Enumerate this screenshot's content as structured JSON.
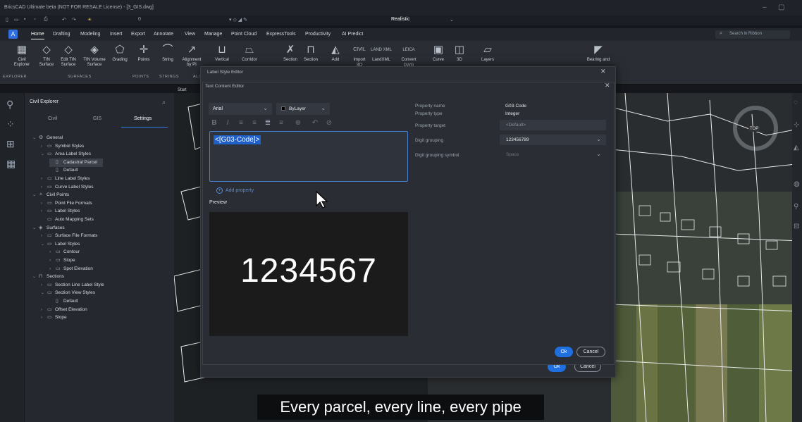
{
  "titlebar": {
    "title": "BricsCAD Ultimate beta (NOT FOR RESALE License) - [3_GIS.dwg]",
    "minimize": "–",
    "restore": "▢"
  },
  "qat": {
    "layer": "0",
    "visual_style": "Realistic"
  },
  "menubar": {
    "app_button": "A",
    "tabs": [
      "Home",
      "Drafting",
      "Modeling",
      "Insert",
      "Export",
      "Annotate",
      "View",
      "Manage",
      "Point Cloud",
      "ExpressTools",
      "Productivity",
      "AI Predict"
    ],
    "search_placeholder": "Search in Ribbon"
  },
  "ribbon": {
    "buttons": [
      {
        "label": "Civil Explorer",
        "icon": "civil-explorer-icon"
      },
      {
        "label": "TIN Surface",
        "icon": "tin-surface-icon"
      },
      {
        "label": "Edit TIN Surface",
        "icon": "edit-tin-icon"
      },
      {
        "label": "TIN Volume Surface",
        "icon": "tin-volume-icon"
      },
      {
        "label": "Grading",
        "icon": "grading-icon"
      },
      {
        "label": "Points",
        "icon": "points-icon"
      },
      {
        "label": "String",
        "icon": "string-icon"
      },
      {
        "label": "Alignment by PI",
        "icon": "alignment-icon"
      },
      {
        "label": "Vertical",
        "icon": "vertical-icon"
      },
      {
        "label": "Corridor",
        "icon": "corridor-icon"
      },
      {
        "label": "Section",
        "icon": "section-icon"
      },
      {
        "label": "Section",
        "icon": "section-view-icon"
      },
      {
        "label": "Add",
        "icon": "add-label-icon"
      },
      {
        "label": "Import",
        "icon": "import-icon"
      },
      {
        "label": "LandXML",
        "icon": "landxml-icon"
      },
      {
        "label": "Convert",
        "icon": "convert-icon"
      },
      {
        "label": "Curve",
        "icon": "curve-icon"
      },
      {
        "label": "3D",
        "icon": "3d-icon"
      },
      {
        "label": "Layers",
        "icon": "layers-icon"
      },
      {
        "label": "Bearing and",
        "icon": "bearing-icon"
      }
    ],
    "small_labels": [
      "CIVIL 3D",
      "LAND XML",
      "LEICA DWG"
    ],
    "groups": [
      "EXPLORER",
      "SURFACES",
      "POINTS",
      "STRINGS",
      "ALI"
    ]
  },
  "explorer": {
    "title": "Civil Explorer",
    "tabs": [
      "Civil",
      "GIS",
      "Settings"
    ],
    "active_tab": "Settings",
    "tree": [
      {
        "label": "General",
        "level": 0,
        "arrow": "v",
        "icon": "gear"
      },
      {
        "label": "Symbol Styles",
        "level": 1,
        "arrow": ">",
        "icon": "folder"
      },
      {
        "label": "Area Label Styles",
        "level": 1,
        "arrow": "v",
        "icon": "folder"
      },
      {
        "label": "Cadastral Parcel",
        "level": 2,
        "arrow": "",
        "icon": "doc",
        "selected": true
      },
      {
        "label": "Default",
        "level": 2,
        "arrow": "",
        "icon": "doc"
      },
      {
        "label": "Line Label Styles",
        "level": 1,
        "arrow": ">",
        "icon": "folder"
      },
      {
        "label": "Curve Label Styles",
        "level": 1,
        "arrow": ">",
        "icon": "folder"
      },
      {
        "label": "Civil Points",
        "level": 0,
        "arrow": "v",
        "icon": "point"
      },
      {
        "label": "Point File Formats",
        "level": 1,
        "arrow": ">",
        "icon": "folder"
      },
      {
        "label": "Label Styles",
        "level": 1,
        "arrow": ">",
        "icon": "folder"
      },
      {
        "label": "Auto Mapping Sets",
        "level": 1,
        "arrow": "",
        "icon": "folder"
      },
      {
        "label": "Surfaces",
        "level": 0,
        "arrow": "v",
        "icon": "surface"
      },
      {
        "label": "Surface File Formats",
        "level": 1,
        "arrow": ">",
        "icon": "folder"
      },
      {
        "label": "Label Styles",
        "level": 1,
        "arrow": "v",
        "icon": "folder"
      },
      {
        "label": "Contour",
        "level": 2,
        "arrow": ">",
        "icon": "folder"
      },
      {
        "label": "Slope",
        "level": 2,
        "arrow": ">",
        "icon": "folder"
      },
      {
        "label": "Spot Elevation",
        "level": 2,
        "arrow": ">",
        "icon": "folder"
      },
      {
        "label": "Sections",
        "level": 0,
        "arrow": "v",
        "icon": "section"
      },
      {
        "label": "Section Line Label Style",
        "level": 1,
        "arrow": ">",
        "icon": "folder"
      },
      {
        "label": "Section View Styles",
        "level": 1,
        "arrow": "v",
        "icon": "folder"
      },
      {
        "label": "Default",
        "level": 2,
        "arrow": "",
        "icon": "doc"
      },
      {
        "label": "Offset Elevation",
        "level": 1,
        "arrow": ">",
        "icon": "folder"
      },
      {
        "label": "Slope",
        "level": 1,
        "arrow": ">",
        "icon": "folder"
      }
    ]
  },
  "doc_tab": "Start",
  "label_style_editor": {
    "title": "Label Style Editor",
    "ok": "Ok",
    "cancel": "Cancel"
  },
  "text_content_editor": {
    "title": "Text Content Editor",
    "font": "Arial",
    "color": "ByLayer",
    "content": "<[G03-Code]>",
    "add_property": "Add property",
    "preview_label": "Preview",
    "preview_value": "1234567",
    "properties": [
      {
        "key": "Property name",
        "value": "G03-Code"
      },
      {
        "key": "Property type",
        "value": "Integer"
      },
      {
        "key": "Property target",
        "value": "<Default>"
      },
      {
        "key": "Digit grouping",
        "value": "123456789"
      },
      {
        "key": "Digit grouping symbol",
        "value": "Space"
      }
    ],
    "ok": "Ok",
    "cancel": "Cancel"
  },
  "map": {
    "view_label": "TOP"
  },
  "subtitle": "Every parcel, every line, every pipe"
}
